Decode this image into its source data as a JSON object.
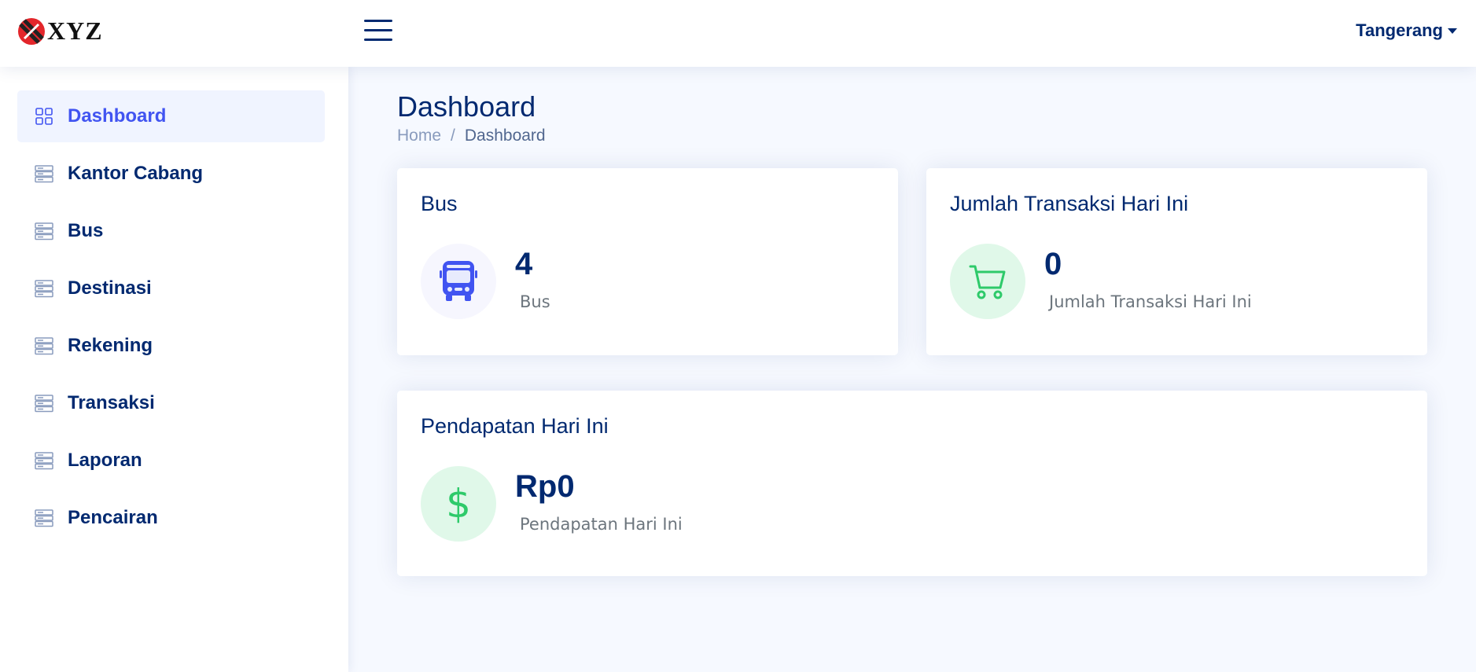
{
  "header": {
    "logo_text": "XYZ",
    "branch_label": "Tangerang"
  },
  "sidebar": {
    "items": [
      {
        "label": "Dashboard",
        "icon": "grid-icon",
        "active": true
      },
      {
        "label": "Kantor Cabang",
        "icon": "list-icon"
      },
      {
        "label": "Bus",
        "icon": "list-icon"
      },
      {
        "label": "Destinasi",
        "icon": "list-icon"
      },
      {
        "label": "Rekening",
        "icon": "list-icon"
      },
      {
        "label": "Transaksi",
        "icon": "list-icon"
      },
      {
        "label": "Laporan",
        "icon": "list-icon"
      },
      {
        "label": "Pencairan",
        "icon": "list-icon"
      }
    ]
  },
  "page": {
    "title": "Dashboard",
    "breadcrumb": {
      "home": "Home",
      "separator": "/",
      "current": "Dashboard"
    }
  },
  "cards": {
    "bus": {
      "title": "Bus",
      "value": "4",
      "caption": "Bus",
      "icon": "bus-icon"
    },
    "transactions": {
      "title": "Jumlah Transaksi Hari Ini",
      "value": "0",
      "caption": "Jumlah Transaksi Hari Ini",
      "icon": "cart-icon"
    },
    "revenue": {
      "title": "Pendapatan Hari Ini",
      "value": "Rp0",
      "caption": "Pendapatan Hari Ini",
      "icon": "dollar-icon",
      "icon_glyph": "$"
    }
  },
  "colors": {
    "primary_text": "#012970",
    "accent": "#4154f1",
    "success": "#2eca6a",
    "muted": "#899bbd"
  }
}
